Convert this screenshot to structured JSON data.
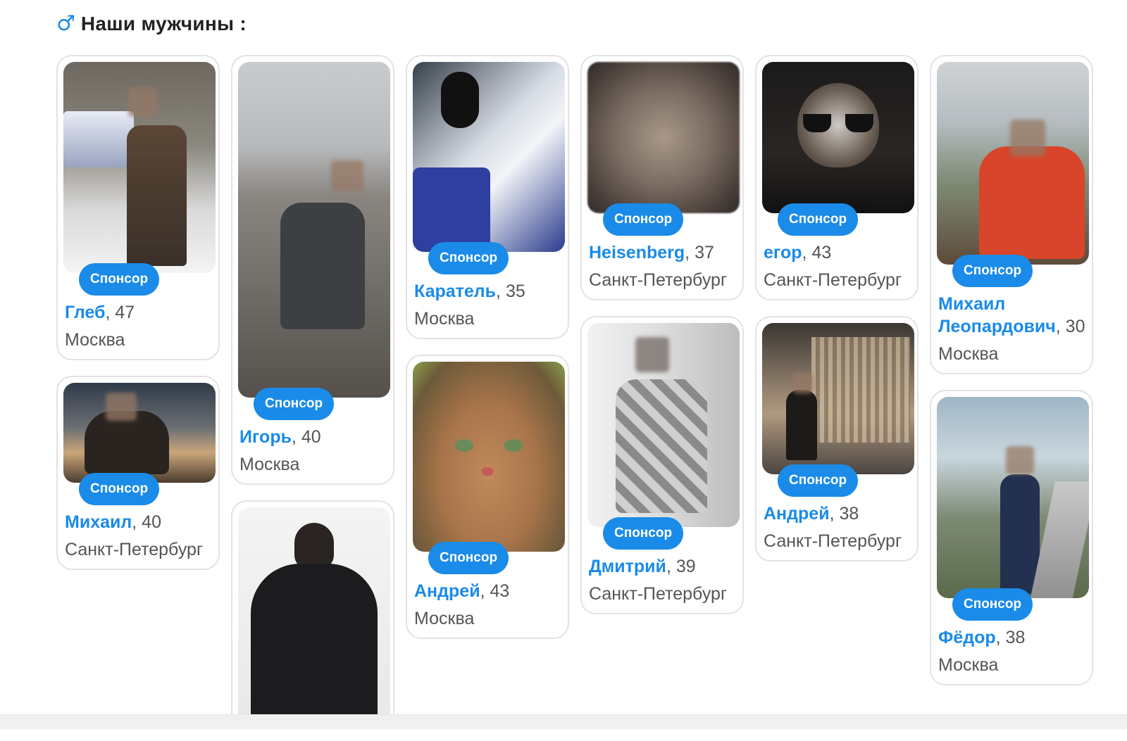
{
  "section": {
    "icon": "male-symbol-icon",
    "symbol": "♂",
    "title": "Наши мужчины :"
  },
  "badge_label": "Спонсор",
  "accent_color": "#1a8be8",
  "profiles": [
    {
      "id": "gleb",
      "name": "Глеб",
      "age": "47",
      "city": "Москва"
    },
    {
      "id": "mikhail",
      "name": "Михаил",
      "age": "40",
      "city": "Санкт-Петербург"
    },
    {
      "id": "igor",
      "name": "Игорь",
      "age": "40",
      "city": "Москва"
    },
    {
      "id": "karatel",
      "name": "Каратель",
      "age": "35",
      "city": "Москва"
    },
    {
      "id": "andrey43",
      "name": "Андрей",
      "age": "43",
      "city": "Москва"
    },
    {
      "id": "heisenberg",
      "name": "Heisenberg",
      "age": "37",
      "city": "Санкт-Петербург"
    },
    {
      "id": "dmitry",
      "name": "Дмитрий",
      "age": "39",
      "city": "Санкт-Петербург"
    },
    {
      "id": "egor",
      "name": "егор",
      "age": "43",
      "city": "Санкт-Петербург"
    },
    {
      "id": "andrey38",
      "name": "Андрей",
      "age": "38",
      "city": "Санкт-Петербург"
    },
    {
      "id": "mikhail-leopardovich",
      "name": "Михаил Леопардович",
      "age": "30",
      "city": "Москва"
    },
    {
      "id": "fedor",
      "name": "Фёдор",
      "age": "38",
      "city": "Москва"
    }
  ],
  "photos": {
    "gleb": "man in leather jacket on street with police car",
    "mikhail": "man sitting at sunset",
    "igor": "man sitting on rocky mountain slope",
    "karatel": "man in black mask in car",
    "andrey43": "orange tabby cat",
    "heisenberg": "blurred face close-up",
    "dmitry": "man in argyle sweater",
    "egor": "raccoon in sunglasses and leather jacket",
    "andrey38": "man in front of cathedral at night",
    "mikhail-leopardovich": "man in red jacket",
    "fedor": "man in suit near office buildings",
    "last": "man in black suit seen from behind"
  }
}
